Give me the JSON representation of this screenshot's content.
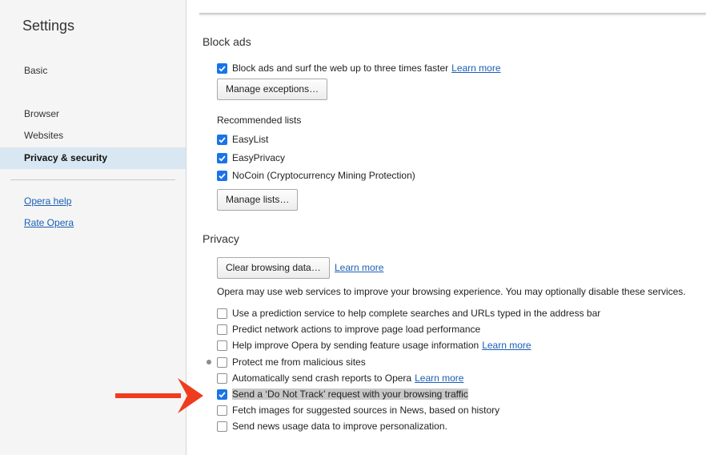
{
  "sidebar": {
    "title": "Settings",
    "items": [
      "Basic",
      "Browser",
      "Websites",
      "Privacy & security"
    ],
    "active_item": "Privacy & security",
    "links": [
      "Opera help",
      "Rate Opera"
    ]
  },
  "block_ads": {
    "title": "Block ads",
    "main_checkbox": {
      "label": "Block ads and surf the web up to three times faster",
      "checked": true,
      "link": "Learn more"
    },
    "manage_exceptions_button": "Manage exceptions…",
    "recommended_lists_label": "Recommended lists",
    "lists": [
      {
        "label": "EasyList",
        "checked": true
      },
      {
        "label": "EasyPrivacy",
        "checked": true
      },
      {
        "label": "NoCoin (Cryptocurrency Mining Protection)",
        "checked": true
      }
    ],
    "manage_lists_button": "Manage lists…"
  },
  "privacy": {
    "title": "Privacy",
    "clear_button": "Clear browsing data…",
    "clear_link": "Learn more",
    "description": "Opera may use web services to improve your browsing experience. You may optionally disable these services.",
    "options": [
      {
        "label": "Use a prediction service to help complete searches and URLs typed in the address bar",
        "checked": false
      },
      {
        "label": "Predict network actions to improve page load performance",
        "checked": false
      },
      {
        "label": "Help improve Opera by sending feature usage information",
        "checked": false,
        "link": "Learn more"
      },
      {
        "label": "Protect me from malicious sites",
        "checked": false
      },
      {
        "label": "Automatically send crash reports to Opera",
        "checked": false,
        "link": "Learn more"
      },
      {
        "label": "Send a ‘Do Not Track’ request with your browsing traffic",
        "checked": true
      },
      {
        "label": "Fetch images for suggested sources in News, based on history",
        "checked": false
      },
      {
        "label": "Send news usage data to improve personalization.",
        "checked": false
      }
    ]
  },
  "colors": {
    "accent": "#1a73e8",
    "link": "#1a5fb4",
    "arrow": "#f03c1e",
    "sidebar_bg": "#f5f5f5",
    "active_bg": "#d8e7f1"
  }
}
